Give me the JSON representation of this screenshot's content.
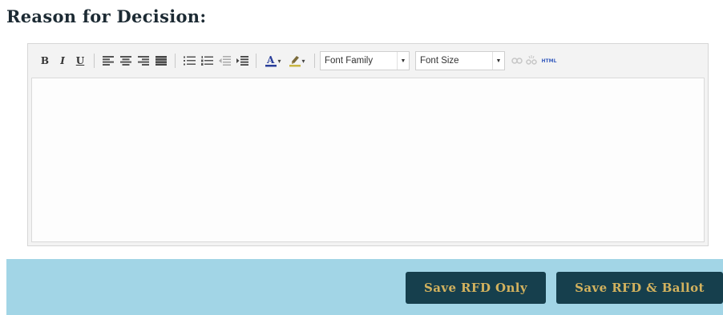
{
  "heading": "Reason for Decision:",
  "toolbar": {
    "bold": "B",
    "italic": "I",
    "underline": "U",
    "font_family": "Font Family",
    "font_size": "Font Size",
    "html": "HTML"
  },
  "editor": {
    "content": ""
  },
  "buttons": {
    "save_rfd_only": "Save RFD Only",
    "save_rfd_ballot": "Save RFD & Ballot"
  },
  "colors": {
    "footer_bg": "#a2d5e6",
    "button_bg": "#163f4d",
    "button_text": "#d3b25e",
    "heading_text": "#1c2a33"
  },
  "icons": [
    "align-left-icon",
    "align-center-icon",
    "align-right-icon",
    "align-justify-icon",
    "bullet-list-icon",
    "numbered-list-icon",
    "outdent-icon",
    "indent-icon",
    "text-color-icon",
    "highlight-color-icon",
    "link-icon",
    "unlink-icon"
  ]
}
